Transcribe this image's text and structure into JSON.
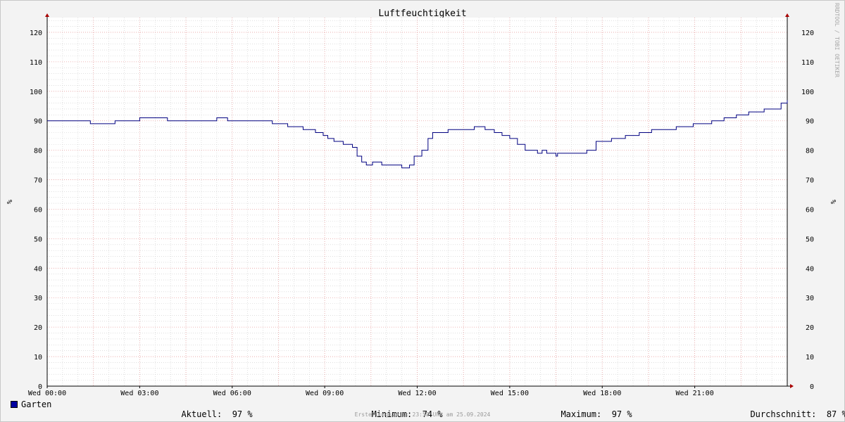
{
  "chart_data": {
    "type": "line",
    "title": "Luftfeuchtigkeit",
    "ylabel": "%",
    "ylabel_right": "%",
    "ylim": [
      0,
      125
    ],
    "yticks": [
      0,
      10,
      20,
      30,
      40,
      50,
      60,
      70,
      80,
      90,
      100,
      110,
      120
    ],
    "xlim_hours": [
      0,
      24
    ],
    "xticks": [
      {
        "hour": 0,
        "label": "Wed 00:00"
      },
      {
        "hour": 3,
        "label": "Wed 03:00"
      },
      {
        "hour": 6,
        "label": "Wed 06:00"
      },
      {
        "hour": 9,
        "label": "Wed 09:00"
      },
      {
        "hour": 12,
        "label": "Wed 12:00"
      },
      {
        "hour": 15,
        "label": "Wed 15:00"
      },
      {
        "hour": 18,
        "label": "Wed 18:00"
      },
      {
        "hour": 21,
        "label": "Wed 21:00"
      }
    ],
    "grid": true,
    "series": [
      {
        "name": "Garten",
        "color": "#000080",
        "x_hours": [
          0.0,
          1.4,
          2.2,
          3.0,
          3.9,
          5.5,
          5.85,
          6.5,
          7.3,
          7.8,
          8.3,
          8.7,
          8.95,
          9.1,
          9.3,
          9.6,
          9.9,
          10.05,
          10.2,
          10.35,
          10.55,
          10.65,
          10.85,
          11.05,
          11.45,
          11.5,
          11.75,
          11.9,
          12.15,
          12.35,
          12.5,
          12.95,
          13.0,
          13.85,
          14.2,
          14.5,
          14.75,
          15.0,
          15.25,
          15.5,
          15.9,
          16.05,
          16.2,
          16.5,
          16.55,
          16.8,
          17.1,
          17.5,
          17.8,
          18.3,
          18.75,
          19.2,
          19.6,
          20.4,
          20.95,
          21.55,
          21.95,
          22.35,
          22.75,
          23.25,
          23.8,
          24.0
        ],
        "values": [
          90,
          89,
          90,
          91,
          90,
          91,
          90,
          90,
          89,
          88,
          87,
          86,
          85,
          84,
          83,
          82,
          81,
          78,
          76,
          75,
          76,
          76,
          75,
          75,
          75,
          74,
          75,
          78,
          80,
          84,
          86,
          86,
          87,
          88,
          87,
          86,
          85,
          84,
          82,
          80,
          79,
          80,
          79,
          78,
          79,
          79,
          79,
          80,
          83,
          84,
          85,
          86,
          87,
          88,
          89,
          90,
          91,
          92,
          93,
          94,
          96,
          97
        ]
      }
    ]
  },
  "legend": {
    "series_label": "Garten",
    "stats": [
      {
        "label": "Aktuell:",
        "value": "97 %"
      },
      {
        "label": "Minimum:",
        "value": "74 %"
      },
      {
        "label": "Maximum:",
        "value": "97 %"
      },
      {
        "label": "Durchschnitt:",
        "value": "87 %"
      }
    ]
  },
  "footer": "Erstellungszeit: 23:58 Uhr am 25.09.2024",
  "credit": "RRDTOOL / TOBI OETIKER",
  "colors": {
    "series": "#000080",
    "major_grid": "#e8a0a0",
    "minor_grid": "#cccccc",
    "axis": "#000000",
    "arrow": "#aa0000",
    "plot_bg": "#ffffff"
  }
}
